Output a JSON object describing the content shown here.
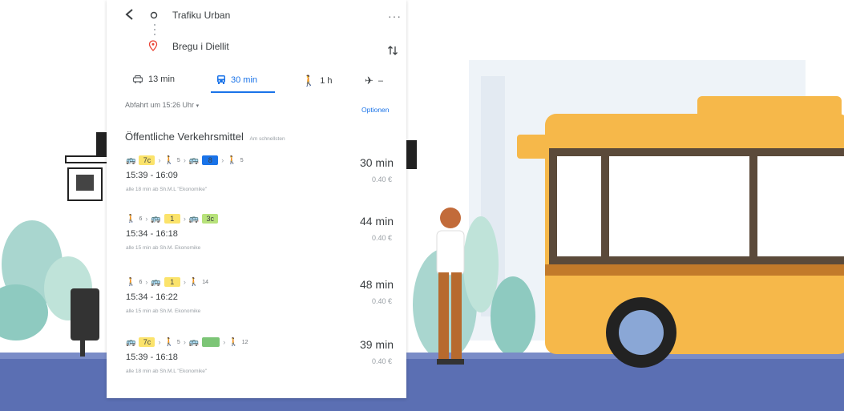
{
  "route_header": {
    "origin": "Trafiku Urban",
    "destination": "Bregu i Diellit",
    "more_icon": "more-horiz-icon",
    "swap_icon": "swap-vertical-icon"
  },
  "modes": [
    {
      "icon": "car-icon",
      "label": "13 min",
      "active": false
    },
    {
      "icon": "transit-icon",
      "label": "30 min",
      "active": true
    },
    {
      "icon": "walk-icon",
      "label": "1 h",
      "active": false
    },
    {
      "icon": "flight-icon",
      "label": "–",
      "active": false
    }
  ],
  "departure_label": "Abfahrt um 15:26 Uhr",
  "options_label": "Optionen",
  "section_title": "Öffentliche Verkehrsmittel",
  "section_badge": "Am schnellsten",
  "routes": [
    {
      "steps": [
        {
          "kind": "bus",
          "line": "7c",
          "color": "#fbe36b"
        },
        {
          "kind": "walk",
          "sub": "5"
        },
        {
          "kind": "bus",
          "line": "8",
          "color": "#1a73e8"
        },
        {
          "kind": "walk",
          "sub": "5"
        }
      ],
      "times": "15:39 - 16:09",
      "duration": "30 min",
      "price": "0.40 €",
      "frequency": "alle 18 min ab Sh.M.L \"Ekonomike\""
    },
    {
      "steps": [
        {
          "kind": "walk",
          "sub": "6"
        },
        {
          "kind": "bus",
          "line": "1",
          "color": "#fbe36b"
        },
        {
          "kind": "bus",
          "line": "3c",
          "color": "#b7e27a"
        }
      ],
      "times": "15:34 - 16:18",
      "duration": "44 min",
      "price": "0.40 €",
      "frequency": "alle 15 min ab Sh.M. Ekonomike"
    },
    {
      "steps": [
        {
          "kind": "walk",
          "sub": "6"
        },
        {
          "kind": "bus",
          "line": "1",
          "color": "#fbe36b"
        },
        {
          "kind": "walk",
          "sub": "14"
        }
      ],
      "times": "15:34 - 16:22",
      "duration": "48 min",
      "price": "0.40 €",
      "frequency": "alle 15 min ab Sh.M. Ekonomike"
    },
    {
      "steps": [
        {
          "kind": "bus",
          "line": "7c",
          "color": "#fbe36b"
        },
        {
          "kind": "walk",
          "sub": "5"
        },
        {
          "kind": "bus",
          "line": "",
          "color": "#7cc576"
        },
        {
          "kind": "walk",
          "sub": "12"
        }
      ],
      "times": "15:39 - 16:18",
      "duration": "39 min",
      "price": "0.40 €",
      "frequency": "alle 18 min ab Sh.M.L \"Ekonomike\""
    }
  ]
}
